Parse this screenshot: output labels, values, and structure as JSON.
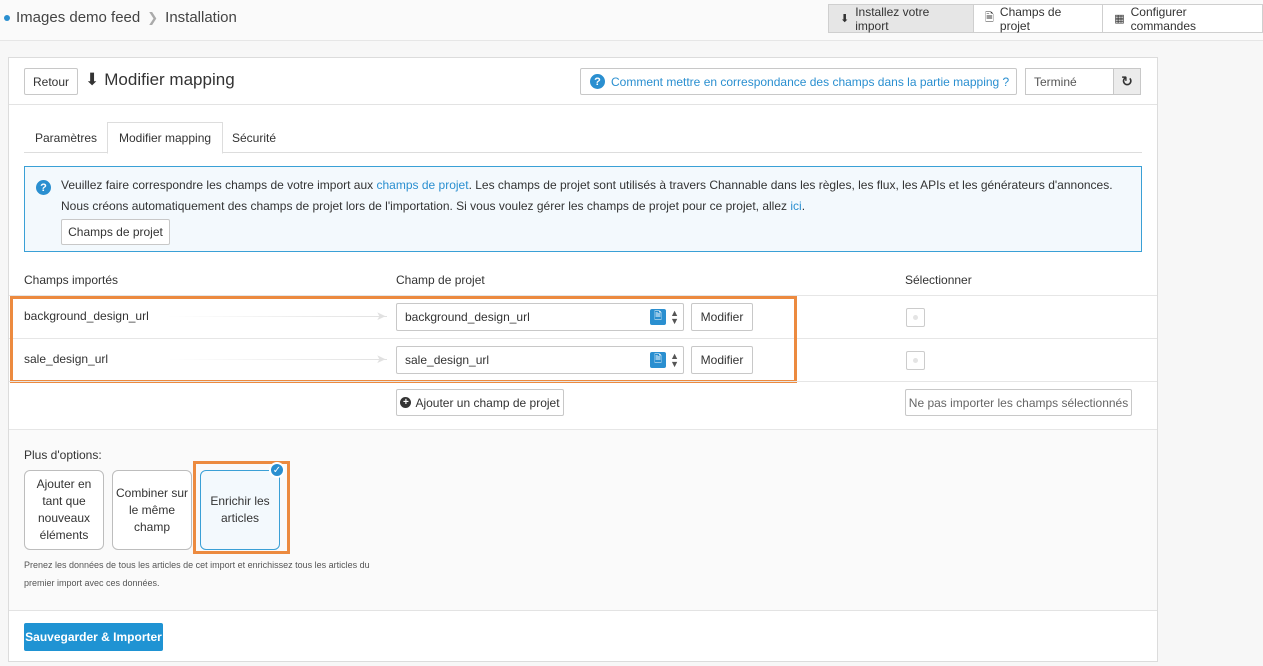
{
  "breadcrumb": {
    "root": "Images demo feed",
    "current": "Installation"
  },
  "top_actions": [
    {
      "label": "Installez votre import",
      "icon": "download-icon"
    },
    {
      "label": "Champs de projet",
      "icon": "document-icon"
    },
    {
      "label": "Configurer commandes",
      "icon": "cube-icon"
    }
  ],
  "header": {
    "back_label": "Retour",
    "title": "Modifier mapping",
    "help_link": "Comment mettre en correspondance des champs dans la partie mapping ?",
    "status": "Terminé"
  },
  "tabs": [
    "Paramètres",
    "Modifier mapping",
    "Sécurité"
  ],
  "info": {
    "line1_pre": "Veuillez faire correspondre les champs de votre import aux",
    "line1_link": "champs de projet",
    "line1_post": ". Les champs de projet sont utilisés à travers Channable dans les règles, les flux, les APIs et les générateurs d'annonces.",
    "line2_pre": "Nous créons automatiquement des champs de projet lors de l'importation. Si vous voulez gérer les champs de projet pour ce projet, allez",
    "line2_link": "ici",
    "line2_post": ".",
    "button": "Champs de projet"
  },
  "table": {
    "headers": {
      "imported": "Champs importés",
      "project": "Champ de projet",
      "select": "Sélectionner"
    },
    "rows": [
      {
        "imported": "background_design_url",
        "project": "background_design_url",
        "modify": "Modifier"
      },
      {
        "imported": "sale_design_url",
        "project": "sale_design_url",
        "modify": "Modifier"
      }
    ],
    "add_button": "Ajouter un champ de projet",
    "no_import_button": "Ne pas importer les champs sélectionnés"
  },
  "options": {
    "label": "Plus d'options:",
    "cards": [
      "Ajouter en tant que nouveaux éléments",
      "Combiner sur le même champ",
      "Enrichir les articles"
    ],
    "selected_index": 2,
    "description": "Prenez les données de tous les articles de cet import et enrichissez tous les articles du premier import avec ces données."
  },
  "footer": {
    "save_label": "Sauvegarder & Importer"
  },
  "colors": {
    "accent": "#2a8fd0",
    "highlight": "#ec8a3f",
    "primary_button": "#1f93d3"
  }
}
